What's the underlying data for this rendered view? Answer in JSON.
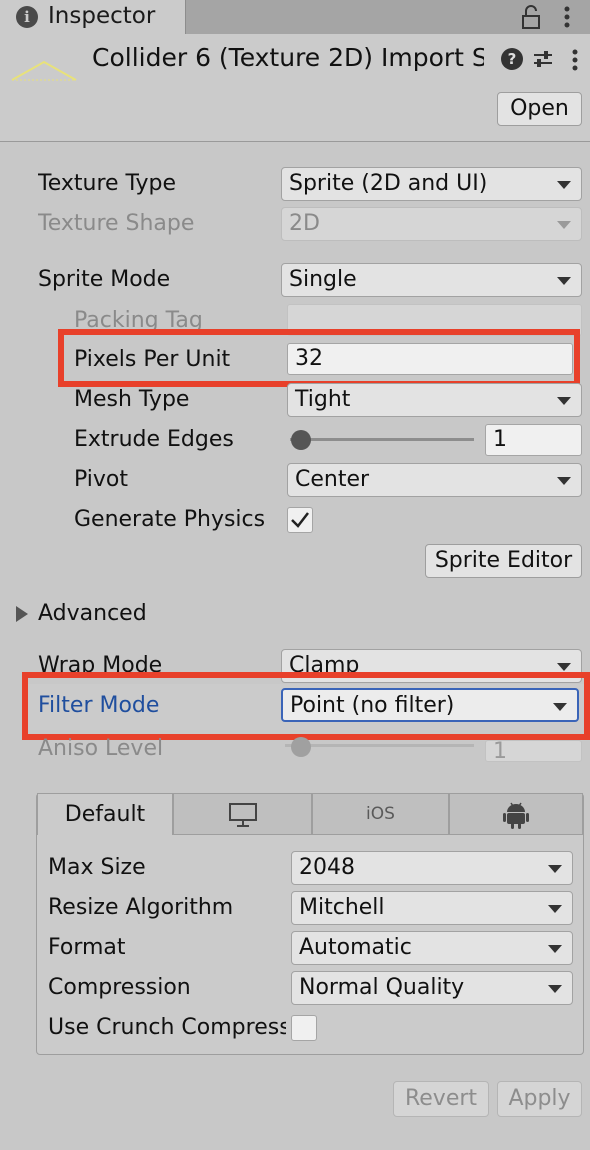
{
  "tab": {
    "title": "Inspector"
  },
  "header": {
    "asset_title": "Collider 6 (Texture 2D) Import S",
    "open_label": "Open"
  },
  "settings": {
    "texture_type": {
      "label": "Texture Type",
      "value": "Sprite (2D and UI)"
    },
    "texture_shape": {
      "label": "Texture Shape",
      "value": "2D"
    },
    "sprite_mode": {
      "label": "Sprite Mode",
      "value": "Single"
    },
    "packing_tag": {
      "label": "Packing Tag",
      "value": ""
    },
    "pixels_per_unit": {
      "label": "Pixels Per Unit",
      "value": "32"
    },
    "mesh_type": {
      "label": "Mesh Type",
      "value": "Tight"
    },
    "extrude_edges": {
      "label": "Extrude Edges",
      "value": "1"
    },
    "pivot": {
      "label": "Pivot",
      "value": "Center"
    },
    "generate_physics": {
      "label": "Generate Physics Shape",
      "checked": true
    },
    "sprite_editor_label": "Sprite Editor",
    "advanced_label": "Advanced",
    "wrap_mode": {
      "label": "Wrap Mode",
      "value": "Clamp"
    },
    "filter_mode": {
      "label": "Filter Mode",
      "value": "Point (no filter)"
    },
    "aniso_level": {
      "label": "Aniso Level",
      "value": "1"
    }
  },
  "platform": {
    "tabs": [
      {
        "label": "Default",
        "icon": null
      },
      {
        "label": "",
        "icon": "monitor-icon"
      },
      {
        "label": "iOS",
        "icon": null
      },
      {
        "label": "",
        "icon": "android-icon"
      }
    ],
    "max_size": {
      "label": "Max Size",
      "value": "2048"
    },
    "resize_algorithm": {
      "label": "Resize Algorithm",
      "value": "Mitchell"
    },
    "format": {
      "label": "Format",
      "value": "Automatic"
    },
    "compression": {
      "label": "Compression",
      "value": "Normal Quality"
    },
    "use_crunch": {
      "label": "Use Crunch Compression",
      "checked": false
    }
  },
  "footer": {
    "revert_label": "Revert",
    "apply_label": "Apply"
  },
  "colors": {
    "highlight": "#e8402a",
    "focus_label": "#1f4e9e"
  }
}
